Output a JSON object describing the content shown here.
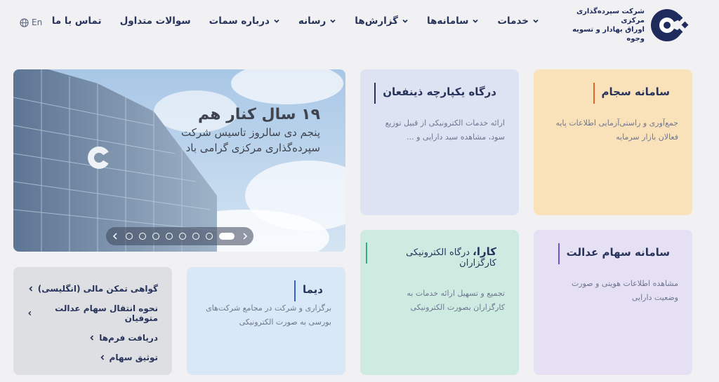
{
  "header": {
    "lang": "En",
    "logo_text_line1": "شرکت سپرده‌گذاری مرکزی",
    "logo_text_line2": "اوراق بهادار و تسویه وجوه",
    "nav": [
      {
        "label": "خدمات",
        "has_menu": true
      },
      {
        "label": "سامانه‌ها",
        "has_menu": true
      },
      {
        "label": "گزارش‌ها",
        "has_menu": true
      },
      {
        "label": "رسانه",
        "has_menu": true
      },
      {
        "label": "درباره سمات",
        "has_menu": true
      },
      {
        "label": "سوالات متداول",
        "has_menu": false
      },
      {
        "label": "تماس با ما",
        "has_menu": false
      }
    ]
  },
  "cards": {
    "sajam": {
      "title": "سامانه سجام",
      "desc": "جمع‌آوری و راستی‌آزمایی اطلاعات پایه فعالان بازار سرمایه",
      "accent": "#e0662a"
    },
    "dinafan": {
      "title": "درگاه یکپارچه ذینفعان",
      "desc": "ارائه خدمات الکترونیکی از قبیل توزیع سود، مشاهده سبد دارایی و ...",
      "accent": "#27335a"
    },
    "edalat": {
      "title": "سامانه سهام عدالت",
      "desc": "مشاهده اطلاعات هویتی و صورت وضعیت دارایی",
      "accent": "#6b55c9"
    },
    "kara": {
      "title_bold": "کارا،",
      "title_rest": " درگاه الکترونیکی کارگزاران",
      "desc": "تجمیع و تسهیل ارائه خدمات به کارگزاران بصورت الکترونیکی",
      "accent": "#3bab83"
    },
    "dima": {
      "title": "دیما",
      "desc": "برگزاری و شرکت در مجامع شرکت‌های بورسی به صورت الکترونیکی",
      "accent": "#3563c9"
    }
  },
  "links": [
    "گواهی تمکن مالی (انگلیسی)",
    "نحوه انتقال سهام عدالت متوفیان",
    "دریافت فرم‌ها",
    "توثیق سهام"
  ],
  "banner": {
    "line1": "۱۹ سال کنار هم",
    "line2": "پنجم دی سالروز تاسیس شرکت",
    "line3": "سپرده‌گذاری مرکزی گرامی باد",
    "slides_count": 8,
    "active_slide": 8
  }
}
